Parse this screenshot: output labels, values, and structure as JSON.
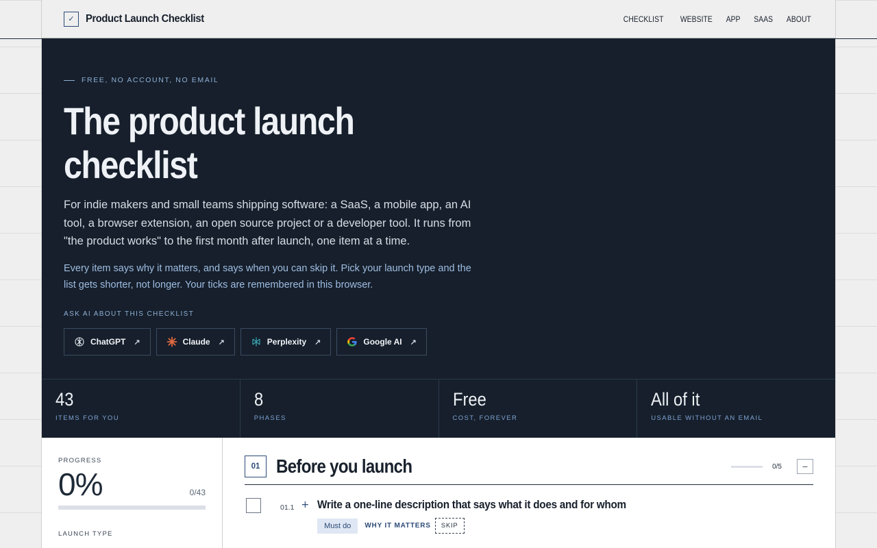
{
  "header": {
    "brand_mark": "✓",
    "brand_name": "Product Launch Checklist",
    "nav": [
      "CHECKLIST",
      "WEBSITE",
      "APP",
      "SAAS",
      "ABOUT"
    ]
  },
  "hero": {
    "eyebrow": "FREE, NO ACCOUNT, NO EMAIL",
    "title": "The product launch checklist",
    "lead": "For indie makers and small teams shipping software: a SaaS, a mobile app, an AI tool, a browser extension, an open source project or a developer tool. It runs from \"the product works\" to the first month after launch, one item at a time.",
    "sub": "Every item says why it matters, and says when you can skip it. Pick your launch type and the list gets shorter, not longer. Your ticks are remembered in this browser.",
    "ask_label": "ASK AI ABOUT THIS CHECKLIST",
    "ai_buttons": [
      {
        "label": "ChatGPT",
        "icon": "chatgpt-icon"
      },
      {
        "label": "Claude",
        "icon": "claude-icon"
      },
      {
        "label": "Perplexity",
        "icon": "perplexity-icon"
      },
      {
        "label": "Google AI",
        "icon": "google-icon"
      }
    ],
    "arrow": "↗"
  },
  "stats": [
    {
      "value": "43",
      "label": "ITEMS FOR YOU"
    },
    {
      "value": "8",
      "label": "PHASES"
    },
    {
      "value": "Free",
      "label": "COST, FOREVER"
    },
    {
      "value": "All of it",
      "label": "USABLE WITHOUT AN EMAIL"
    }
  ],
  "sidebar": {
    "progress_label": "PROGRESS",
    "percent": "0%",
    "count": "0/43",
    "progress_fraction": 0,
    "launch_type_label": "LAUNCH TYPE"
  },
  "phase": {
    "number": "01",
    "title": "Before you launch",
    "count": "0/5",
    "collapse": "−",
    "item": {
      "number": "01.1",
      "plus": "+",
      "title": "Write a one-line description that says what it does and for whom",
      "tag": "Must do",
      "why": "WHY IT MATTERS",
      "skip": "SKIP"
    }
  },
  "colors": {
    "hero_bg": "#161f2b",
    "accent": "#2c4a77",
    "eyebrow": "#8fb0d8"
  }
}
